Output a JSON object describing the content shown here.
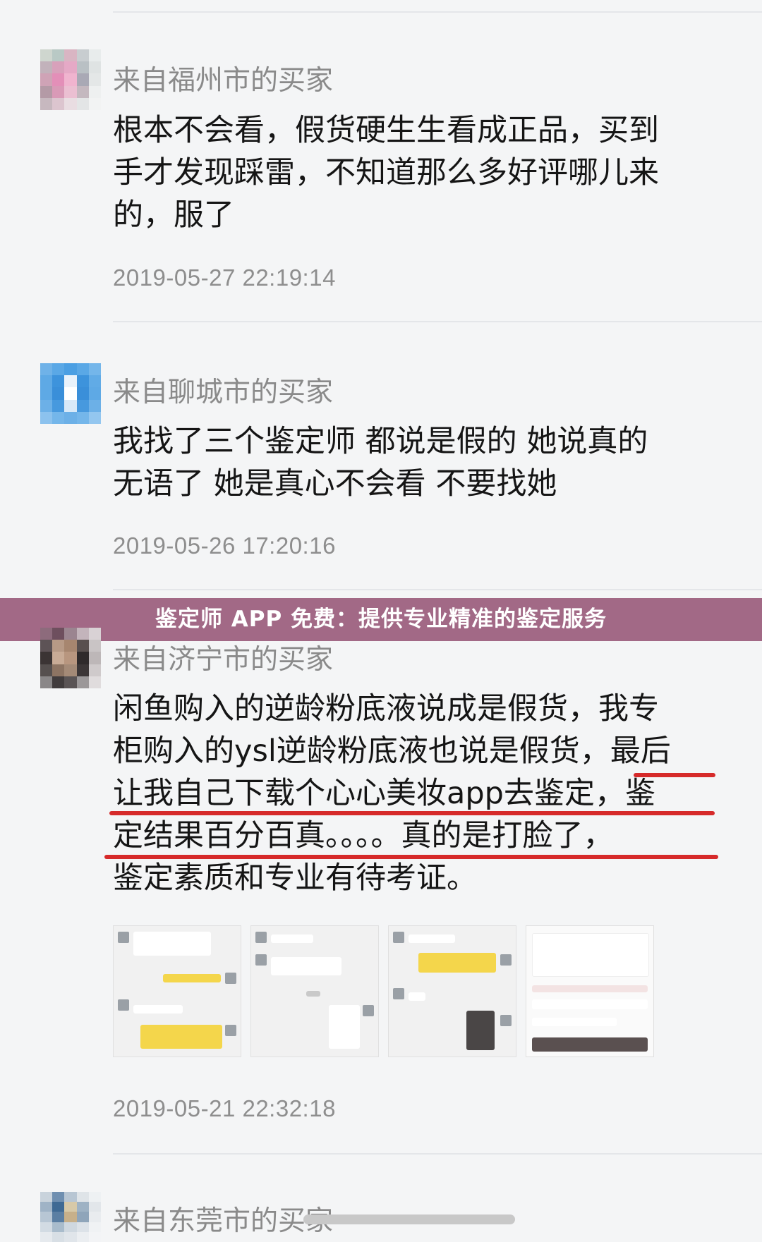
{
  "reviews": [
    {
      "buyer": "来自福州市的买家",
      "lines": [
        "根本不会看，假货硬生生看成正品，买到",
        "手才发现踩雷，不知道那么多好评哪儿来",
        "的，服了"
      ],
      "time": "2019-05-27 22:19:14"
    },
    {
      "buyer": "来自聊城市的买家",
      "lines": [
        "我找了三个鉴定师 都说是假的 她说真的",
        "无语了 她是真心不会看 不要找她"
      ],
      "time": "2019-05-26 17:20:16"
    },
    {
      "buyer": "来自济宁市的买家",
      "lines": [
        "闲鱼购入的逆龄粉底液说成是假货，我专",
        "柜购入的ysl逆龄粉底液也说是假货，最后",
        "让我自己下载个心心美妆app去鉴定，鉴",
        "定结果百分百真。。。。真的是打脸了，",
        "鉴定素质和专业有待考证。"
      ],
      "time": "2019-05-21 22:32:18"
    },
    {
      "buyer": "来自东莞市的买家"
    }
  ],
  "banner": {
    "text": "鉴定师 APP 免费：提供专业精准的鉴定服务"
  },
  "colors": {
    "banner": "#a26986",
    "underline": "#d62a2a",
    "page_bg": "#f4f5f6"
  }
}
